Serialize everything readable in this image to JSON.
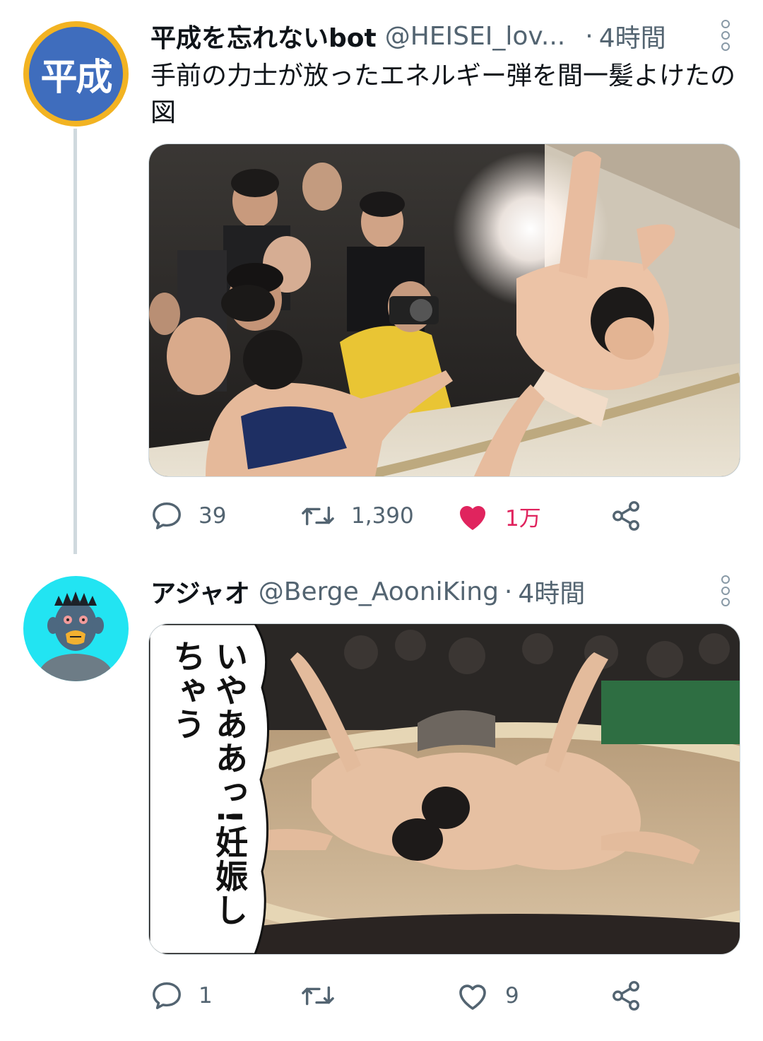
{
  "tweets": [
    {
      "avatar_text": "平成",
      "name": "平成を忘れないbot",
      "handle": "@HEISEI_lov...",
      "dot": "·",
      "time": "4時間",
      "text": "手前の力士が放ったエネルギー弾を間一髪よけたの図",
      "reply_count": "39",
      "retweet_count": "1,390",
      "like_count": "1万",
      "liked": true
    },
    {
      "name": "アジャオ",
      "handle": "@Berge_AooniKing",
      "dot": "·",
      "time": "4時間",
      "overlay_text": "いやああっ!妊娠しちゃう",
      "reply_count": "1",
      "retweet_count": "",
      "like_count": "9",
      "liked": false
    }
  ],
  "icons": {
    "reply": "speech-bubble",
    "retweet": "retweet-arrows",
    "like": "heart",
    "share": "share-nodes",
    "more": "vertical-dots"
  },
  "colors": {
    "like_active": "#e0245e",
    "secondary_text": "#536471",
    "thread_line": "#cfd9de",
    "avatar1_bg": "#3f6dbd",
    "avatar1_ring": "#f2b322",
    "avatar2_bg": "#22e4f2"
  }
}
